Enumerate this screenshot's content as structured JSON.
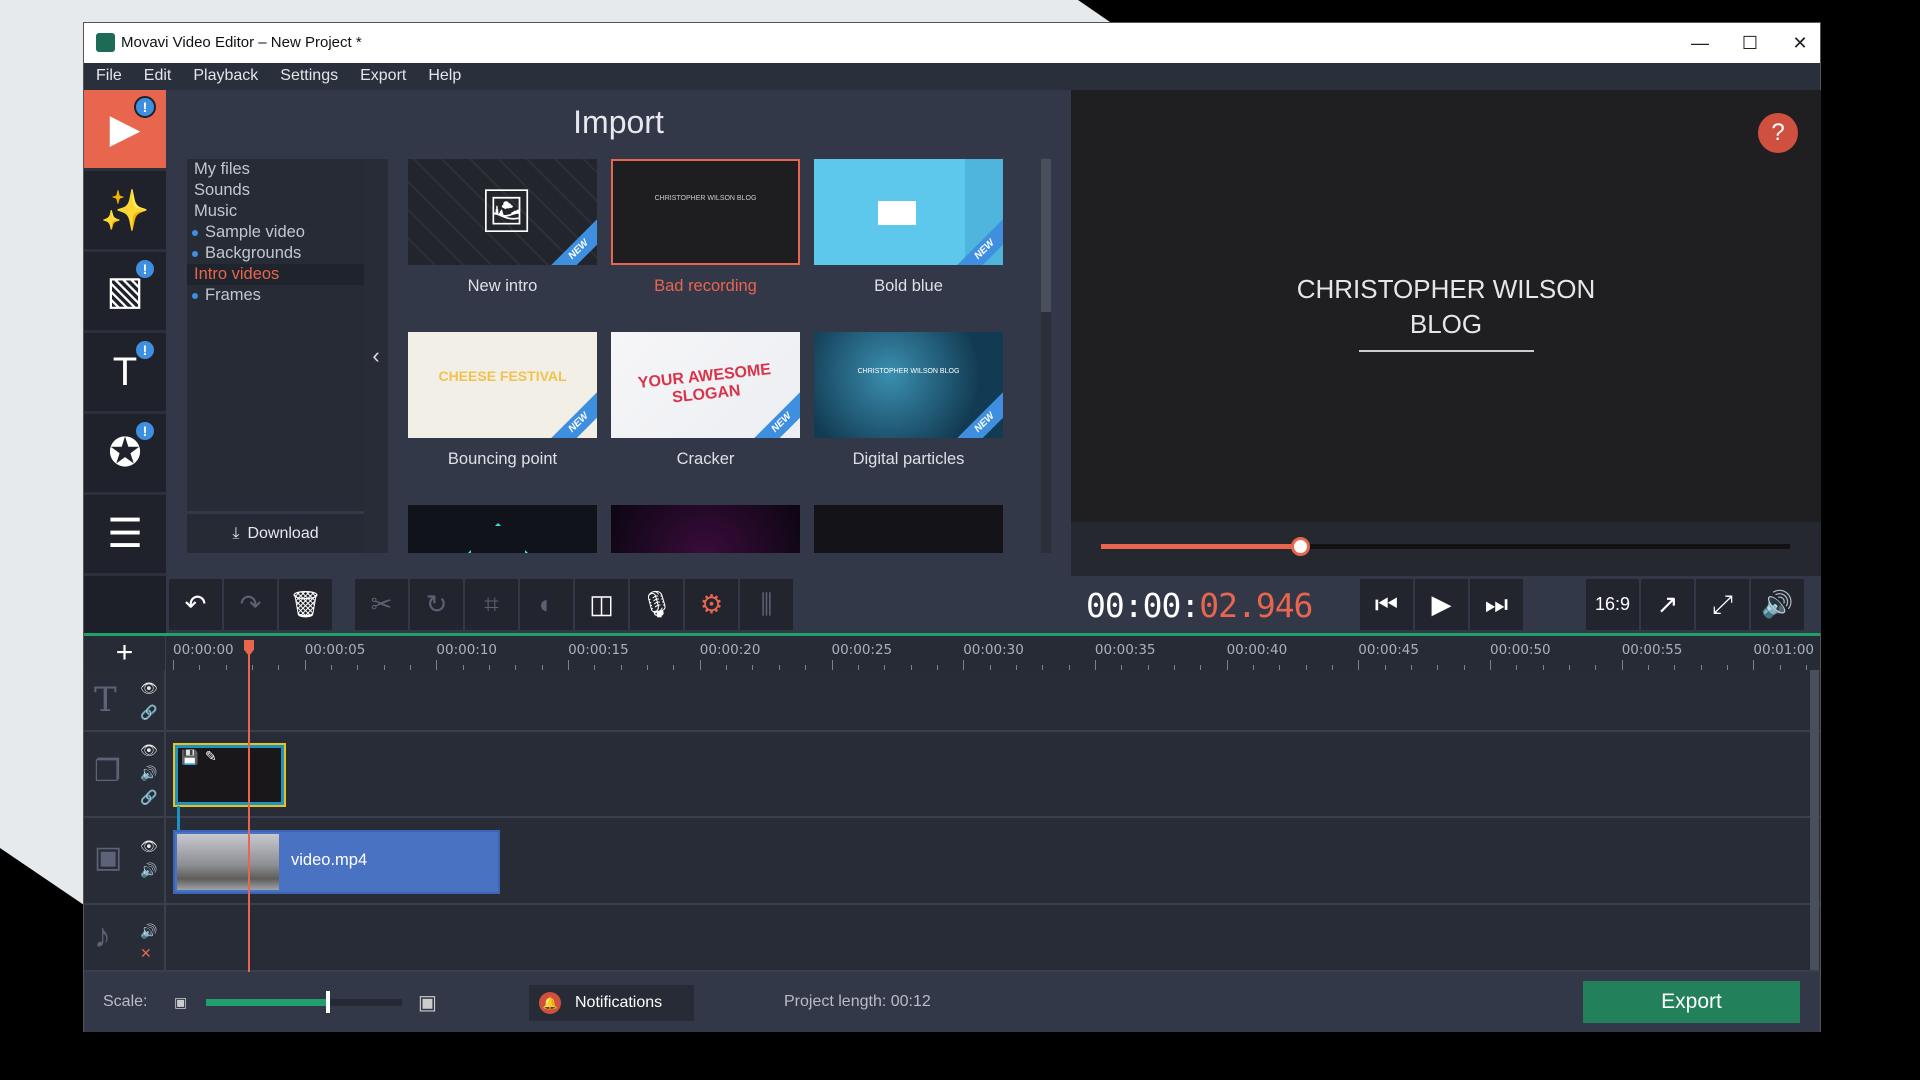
{
  "window": {
    "title": "Movavi Video Editor – New Project *",
    "controls": [
      "—",
      "☐",
      "✕"
    ]
  },
  "menu": [
    "File",
    "Edit",
    "Playback",
    "Settings",
    "Export",
    "Help"
  ],
  "sidebar": [
    {
      "icon": "import-film-icon",
      "glyph": "▶",
      "badge": "!",
      "active": true
    },
    {
      "icon": "magic-wand-icon",
      "glyph": "✨",
      "badge": ""
    },
    {
      "icon": "transitions-icon",
      "glyph": "▧",
      "badge": "!"
    },
    {
      "icon": "titles-icon",
      "glyph": "T",
      "badge": "!"
    },
    {
      "icon": "stickers-star-icon",
      "glyph": "✪",
      "badge": "!"
    },
    {
      "icon": "more-list-icon",
      "glyph": "☰",
      "badge": ""
    }
  ],
  "import": {
    "title": "Import",
    "categories": [
      {
        "label": "My files",
        "bullet": false
      },
      {
        "label": "Sounds",
        "bullet": false
      },
      {
        "label": "Music",
        "bullet": false
      },
      {
        "label": "Sample video",
        "bullet": true
      },
      {
        "label": "Backgrounds",
        "bullet": true
      },
      {
        "label": "Intro videos",
        "bullet": false,
        "selected": true
      },
      {
        "label": "Frames",
        "bullet": true
      }
    ],
    "download_label": "Download",
    "items": [
      {
        "label": "New intro",
        "badge": "NEW"
      },
      {
        "label": "Bad recording",
        "selected": true,
        "thumb_text": "CHRISTOPHER WILSON BLOG"
      },
      {
        "label": "Bold blue",
        "badge": "NEW"
      },
      {
        "label": "Bouncing point",
        "badge": "NEW",
        "thumb_text": "CHEESE FESTIVAL"
      },
      {
        "label": "Cracker",
        "badge": "NEW",
        "thumb_text": "YOUR AWESOME SLOGAN"
      },
      {
        "label": "Digital particles",
        "badge": "NEW",
        "thumb_text": "CHRISTOPHER WILSON BLOG"
      },
      {
        "label": ""
      },
      {
        "label": ""
      },
      {
        "label": ""
      }
    ]
  },
  "preview": {
    "line1": "CHRISTOPHER WILSON",
    "line2": "BLOG",
    "help": "?",
    "progress": 0.29
  },
  "toolbar": [
    {
      "name": "undo",
      "glyph": "↶",
      "dim": false
    },
    {
      "name": "redo",
      "glyph": "↷",
      "dim": true
    },
    {
      "name": "delete",
      "glyph": "🗑",
      "dim": false
    },
    {
      "name": "cut",
      "glyph": "✂",
      "dim": true
    },
    {
      "name": "rotate",
      "glyph": "↻",
      "dim": true
    },
    {
      "name": "crop",
      "glyph": "⌗",
      "dim": true
    },
    {
      "name": "color-adjust",
      "glyph": "◐",
      "dim": true
    },
    {
      "name": "transition",
      "glyph": "◫",
      "dim": false
    },
    {
      "name": "microphone",
      "glyph": "🎙",
      "dim": false
    },
    {
      "name": "settings",
      "glyph": "⚙",
      "dim": false,
      "color": "#e8654e"
    },
    {
      "name": "equalizer",
      "glyph": "⫼",
      "dim": true
    }
  ],
  "timecode": {
    "white": "00:00:",
    "red": "02.946"
  },
  "transport": [
    {
      "name": "previous",
      "glyph": "⏮"
    },
    {
      "name": "play",
      "glyph": "▶"
    },
    {
      "name": "next",
      "glyph": "⏭"
    }
  ],
  "view_controls": [
    {
      "name": "aspect-ratio",
      "glyph": "16:9"
    },
    {
      "name": "detach-preview",
      "glyph": "↗"
    },
    {
      "name": "fullscreen",
      "glyph": "⤢"
    },
    {
      "name": "volume",
      "glyph": "🔊"
    }
  ],
  "ruler": [
    "00:00:00",
    "00:00:05",
    "00:00:10",
    "00:00:15",
    "00:00:20",
    "00:00:25",
    "00:00:30",
    "00:00:35",
    "00:00:40",
    "00:00:45",
    "00:00:50",
    "00:00:55",
    "00:01:00"
  ],
  "tracks": {
    "video_clip": "video.mp4"
  },
  "bottom": {
    "scale_label": "Scale:",
    "scale_value": 0.62,
    "notifications": "Notifications",
    "project_length_label": "Project length:",
    "project_length": "00:12",
    "export": "Export"
  },
  "colors": {
    "accent": "#e8654e",
    "green": "#22a06b",
    "blue": "#3e8fe0",
    "export": "#22805a"
  }
}
